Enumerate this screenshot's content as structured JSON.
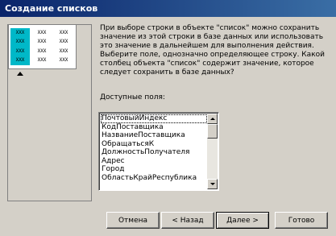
{
  "window": {
    "title": "Создание списков"
  },
  "illustration": {
    "cell_text": "XXX",
    "highlight_color": "#00b8c8"
  },
  "description": "При выборе строки в объекте \"список\" можно сохранить значение из этой строки в базе данных или использовать это значение в дальнейшем для выполнения действия. Выберите поле, однозначно определяющее строку. Какой столбец объекта \"список\" содержит значение, которое следует сохранить в базе данных?",
  "fields": {
    "label": "Доступные поля:",
    "items": [
      "ПочтовыйИндекс",
      "КодПоставщика",
      "НазваниеПоставщика",
      "ОбращатьсяК",
      "ДолжностьПолучателя",
      "Адрес",
      "Город",
      "ОбластьКрайРеспублика"
    ],
    "selected": "ПочтовыйИндекс"
  },
  "buttons": {
    "cancel": "Отмена",
    "back": "< Назад",
    "next": "Далее >",
    "finish": "Готово"
  }
}
